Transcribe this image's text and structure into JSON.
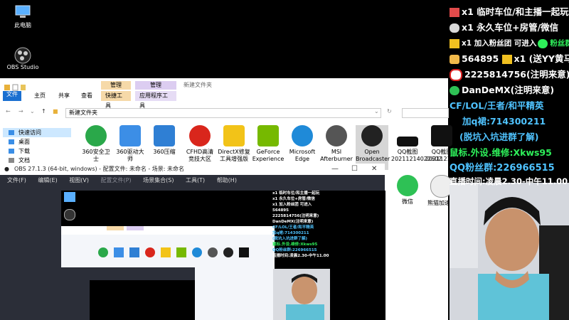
{
  "desktop": {
    "icons": [
      {
        "label": "此电脑"
      },
      {
        "label": "OBS Studio"
      }
    ]
  },
  "explorer": {
    "ribbon": {
      "tabs": [
        "文件",
        "主页",
        "共享",
        "查看",
        "快捷工具",
        "应用程序工具"
      ],
      "context_headers": [
        "管理",
        "管理"
      ],
      "title": "新建文件夹"
    },
    "address": {
      "path": "新建文件夹"
    },
    "sidebar": [
      "快速访问",
      "桌面",
      "下载",
      "文档"
    ],
    "files": [
      {
        "label": "360安全卫士",
        "color": "#2aa84a"
      },
      {
        "label": "360驱动大师",
        "color": "#3c8ee6"
      },
      {
        "label": "360压缩",
        "color": "#2f7fd4"
      },
      {
        "label": "CFHD高清竞技大区",
        "color": "#d9261c"
      },
      {
        "label": "DirectX修复工具增强版",
        "color": "#f2c318"
      },
      {
        "label": "GeForce Experience",
        "color": "#76b900"
      },
      {
        "label": "Microsoft Edge",
        "color": "#1f8ad8"
      },
      {
        "label": "MSI Afterburner",
        "color": "#555"
      },
      {
        "label": "Open Broadcaster Software",
        "color": "#222"
      },
      {
        "label": "QQ截图20211214022602",
        "color": "#111"
      },
      {
        "label": "QQ截图20211214162545",
        "color": "#111"
      },
      {
        "label": "微信",
        "color": "#2ec155"
      },
      {
        "label": "熊猫加速器",
        "color": "#eee"
      }
    ]
  },
  "obs": {
    "title": "OBS 27.1.3 (64-bit, windows) - 配置文件: 未命名 - 场景: 未命名",
    "menu": [
      "文件(F)",
      "编辑(E)",
      "视图(V)",
      "配置文件(P)",
      "场景集合(S)",
      "工具(T)",
      "帮助(H)"
    ]
  },
  "overlay": {
    "lines": [
      {
        "text": "x1 临时车位/和主播一起玩",
        "icon": "car-icon",
        "color": "#ffffff"
      },
      {
        "text": "x1 永久车位+房管/微信",
        "icon": "rocket-icon",
        "color": "#ffffff"
      },
      {
        "text": "x1 加入粉丝团 可进入",
        "icon": "ticket-icon",
        "color": "#ffffff"
      },
      {
        "text": "564895",
        "icon": "badge-icon",
        "color": "#ffffff"
      },
      {
        "text": "2225814756(注明来意)",
        "icon": "qq-penguin-icon",
        "color": "#ffffff"
      },
      {
        "text": "DanDeMX(注明来意)",
        "icon": "wechat-icon",
        "color": "#ffffff"
      },
      {
        "text": "CF/LOL/王者/和平精英",
        "icon": "",
        "color": "#4fc3ff"
      },
      {
        "text": "加q裙:714300211",
        "icon": "",
        "color": "#4fc3ff"
      },
      {
        "text": "(脱坑入坑进群了解)",
        "icon": "",
        "color": "#4fc3ff"
      },
      {
        "text": "鼠标.外设.维修:Xkws95",
        "icon": "",
        "color": "#2ef05a"
      },
      {
        "text": "QQ粉丝群:226966515",
        "icon": "",
        "color": "#4fc3ff"
      },
      {
        "text": "直播时间:凌晨2.30-中午11.00",
        "icon": "",
        "color": "#ffffff"
      }
    ],
    "fans_group_suffix": "粉丝群",
    "badge_suffix": "x1 (送YY黄马)"
  }
}
